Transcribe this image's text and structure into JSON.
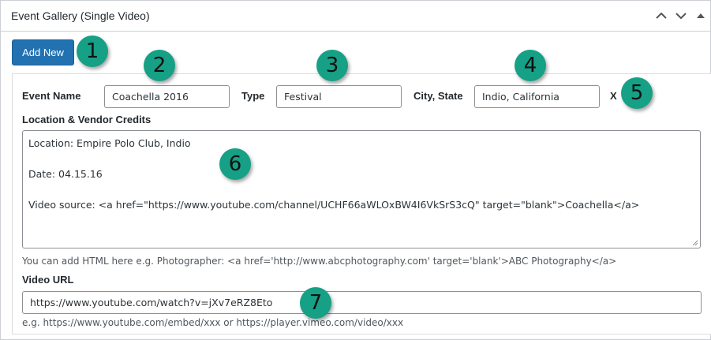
{
  "panel": {
    "title": "Event Gallery (Single Video)",
    "icons": [
      "chevron-up-icon",
      "chevron-down-icon",
      "toggle-arrow-icon"
    ]
  },
  "add_new_label": "Add New",
  "event": {
    "name_label": "Event Name",
    "name_value": "Coachella 2016",
    "type_label": "Type",
    "type_value": "Festival",
    "city_label": "City, State",
    "city_value": "Indio, California",
    "remove_label": "X"
  },
  "credits": {
    "label": "Location & Vendor Credits",
    "lines": [
      "Location: Empire Polo Club, Indio",
      "Date: 04.15.16",
      "Video source: <a href=\"https://www.youtube.com/channel/UCHF66aWLOxBW4I6VkSrS3cQ\" target=\"blank\">Coachella</a>"
    ],
    "help": "You can add HTML here e.g. Photographer: <a href='http://www.abcphotography.com' target='blank'>ABC Photography</a>"
  },
  "video": {
    "label": "Video URL",
    "value": "https://www.youtube.com/watch?v=jXv7eRZ8Eto",
    "help": "e.g. https://www.youtube.com/embed/xxx or https://player.vimeo.com/video/xxx"
  },
  "callouts": [
    "1",
    "2",
    "3",
    "4",
    "5",
    "6",
    "7"
  ],
  "colors": {
    "button": "#2271b1",
    "callout": "#16a085"
  }
}
